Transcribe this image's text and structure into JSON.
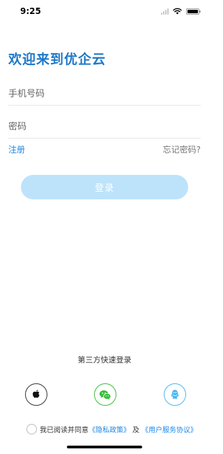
{
  "status_bar": {
    "time": "9:25"
  },
  "title": "欢迎来到优企云",
  "phone_field": {
    "placeholder": "手机号码",
    "value": ""
  },
  "password_field": {
    "placeholder": "密码",
    "value": ""
  },
  "links": {
    "register": "注册",
    "forgot_password": "忘记密码?"
  },
  "login_button": {
    "label": "登录"
  },
  "third_party": {
    "title": "第三方快速登录",
    "providers": [
      "apple-icon",
      "wechat-icon",
      "qq-icon"
    ]
  },
  "agreement": {
    "prefix": "我已阅读并同意",
    "privacy": "《隐私政策》",
    "connector": "及",
    "service": "《用户服务协议》"
  },
  "colors": {
    "title": "#1e78c8",
    "link": "#1e88e5",
    "login_button_bg": "#bde3fb",
    "wechat": "#3bbd3b",
    "qq": "#4ab6ee"
  }
}
